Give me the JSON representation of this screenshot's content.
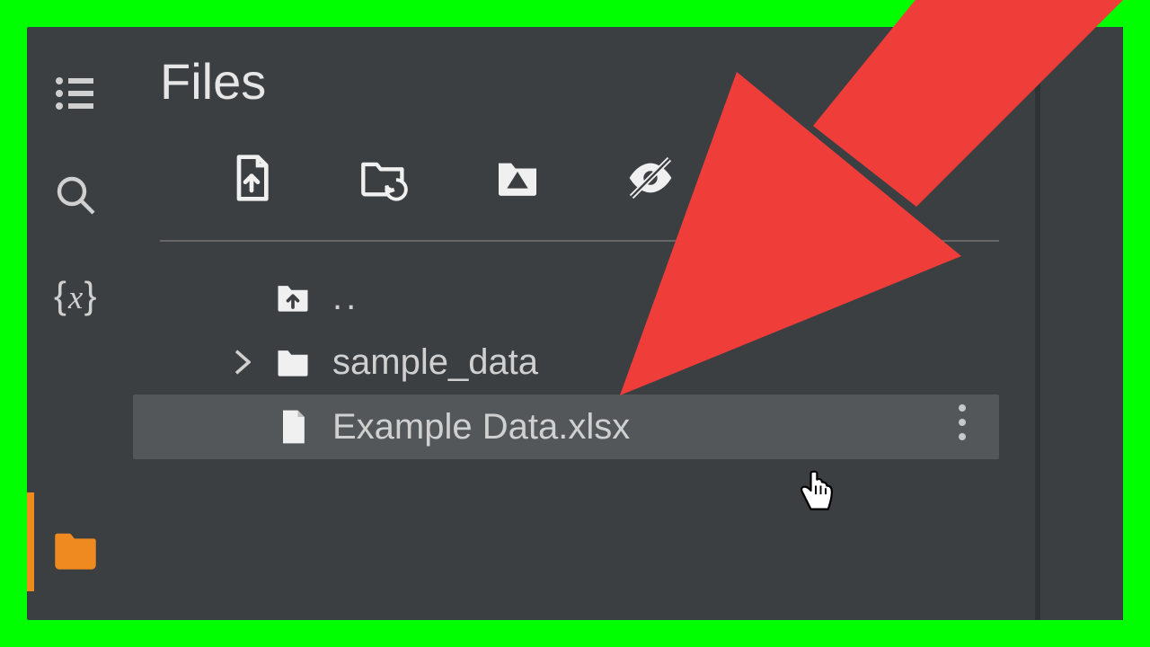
{
  "panel": {
    "title": "Files",
    "tree": {
      "parent_label": "..",
      "folder_name": "sample_data",
      "file_name": "Example Data.xlsx"
    }
  },
  "colors": {
    "accent": "#ef8a20",
    "arrow": "#ef3d3a",
    "background": "#3c3f42",
    "selected": "#53575a",
    "border_green": "#00ff00"
  }
}
